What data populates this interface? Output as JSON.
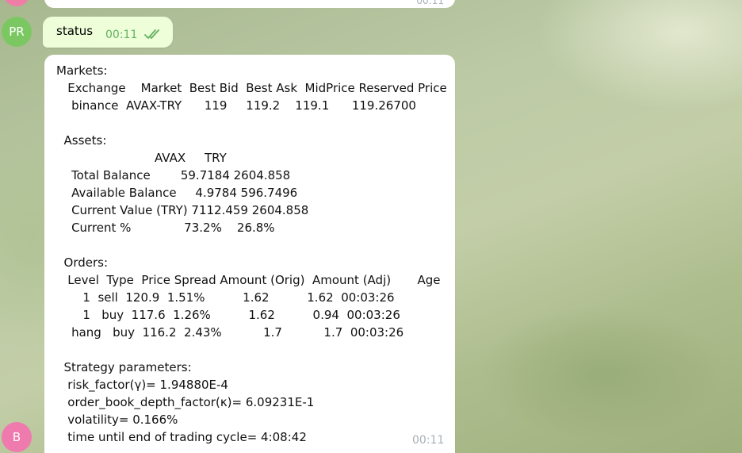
{
  "previous_message": {
    "time": "00:11"
  },
  "avatars": {
    "user": "PR",
    "bot": "B"
  },
  "outgoing_message": {
    "text": "status",
    "time": "00:11",
    "status_icon": "double-check-icon"
  },
  "incoming_message": {
    "text": "Markets:\n   Exchange    Market  Best Bid  Best Ask  MidPrice Reserved Price\n    binance  AVAX-TRY      119     119.2    119.1      119.26700\n\n  Assets:\n                          AVAX     TRY\n    Total Balance        59.7184 2604.858\n    Available Balance     4.9784 596.7496\n    Current Value (TRY) 7112.459 2604.858\n    Current %              73.2%    26.8%\n\n  Orders:\n   Level  Type  Price Spread Amount (Orig)  Amount (Adj)       Age\n       1  sell  120.9  1.51%          1.62          1.62  00:03:26\n       1   buy  117.6  1.26%          1.62          0.94  00:03:26\n    hang   buy  116.2  2.43%           1.7           1.7  00:03:26\n\n  Strategy parameters:\n   risk_factor(γ)= 1.94880E-4\n   order_book_depth_factor(κ)= 6.09231E-1\n   volatility= 0.166%\n   time until end of trading cycle= 4:08:42",
    "time": "00:11"
  }
}
